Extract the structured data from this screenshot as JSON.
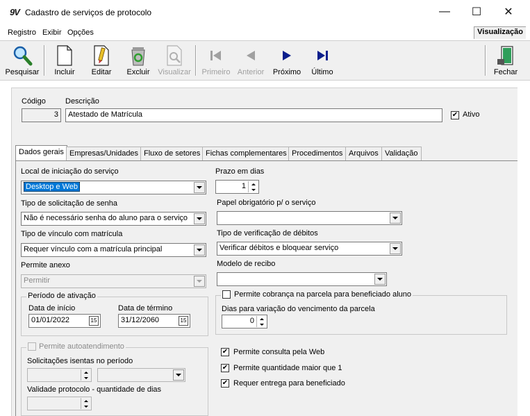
{
  "window": {
    "title": "Cadastro de serviços de protocolo",
    "app_icon": "9V",
    "controls": {
      "minimize": "—",
      "maximize": "☐",
      "close": "✕"
    }
  },
  "menu": {
    "items": [
      "Registro",
      "Exibir",
      "Opções"
    ],
    "mode_label": "Visualização"
  },
  "toolbar": {
    "buttons": [
      {
        "label": "Pesquisar",
        "icon": "magnifier-icon",
        "enabled": true
      },
      {
        "label": "Incluir",
        "icon": "new-page-icon",
        "enabled": true
      },
      {
        "label": "Editar",
        "icon": "edit-pencil-icon",
        "enabled": true
      },
      {
        "label": "Excluir",
        "icon": "recycle-bin-icon",
        "enabled": true
      },
      {
        "label": "Visualizar",
        "icon": "view-page-icon",
        "enabled": false
      },
      {
        "label": "Primeiro",
        "icon": "first-record-icon",
        "enabled": false
      },
      {
        "label": "Anterior",
        "icon": "previous-record-icon",
        "enabled": false
      },
      {
        "label": "Próximo",
        "icon": "next-record-icon",
        "enabled": true
      },
      {
        "label": "Último",
        "icon": "last-record-icon",
        "enabled": true
      },
      {
        "label": "Fechar",
        "icon": "exit-door-icon",
        "enabled": true
      }
    ],
    "colors": {
      "nav_active": "#0a1e8c",
      "nav_disabled": "#a0a0a0"
    }
  },
  "header": {
    "codigo_label": "Código",
    "codigo_value": "3",
    "descricao_label": "Descrição",
    "descricao_value": "Atestado de Matrícula",
    "ativo_label": "Ativo",
    "ativo_checked": true
  },
  "tabs": [
    {
      "label": "Dados gerais",
      "active": true
    },
    {
      "label": "Empresas/Unidades",
      "active": false
    },
    {
      "label": "Fluxo de setores",
      "active": false
    },
    {
      "label": "Fichas complementares",
      "active": false
    },
    {
      "label": "Procedimentos",
      "active": false
    },
    {
      "label": "Arquivos",
      "active": false
    },
    {
      "label": "Validação",
      "active": false
    }
  ],
  "form": {
    "local_label": "Local de iniciação do serviço",
    "local_value": "Desktop e Web",
    "prazo_label": "Prazo em dias",
    "prazo_value": "1",
    "tipo_senha_label": "Tipo de solicitação de senha",
    "tipo_senha_value": "Não é necessário senha do aluno para o serviço",
    "papel_label": "Papel obrigatório p/ o serviço",
    "papel_value": "",
    "vinculo_label": "Tipo de vínculo com matrícula",
    "vinculo_value": "Requer vínculo com a matrícula principal",
    "debitos_label": "Tipo de verificação de débitos",
    "debitos_value": "Verificar débitos e bloquear serviço",
    "anexo_label": "Permite anexo",
    "anexo_value": "Permitir",
    "recibo_label": "Modelo de recibo",
    "recibo_value": "",
    "periodo": {
      "title": "Período de ativação",
      "inicio_label": "Data de início",
      "inicio_value": "01/01/2022",
      "termino_label": "Data de término",
      "termino_value": "31/12/2060",
      "cal_icon": "15"
    },
    "cobranca": {
      "title": "Permite cobrança na parcela para beneficiado aluno",
      "checked": false,
      "dias_label": "Dias para variação do vencimento da parcela",
      "dias_value": "0"
    },
    "autoatendimento": {
      "title": "Permite autoatendimento",
      "checked": false,
      "isentas_label": "Solicitações isentas no período",
      "isentas_value": "",
      "periodo_value": "",
      "validade_label": "Validade protocolo - quantidade de dias",
      "validade_value": ""
    },
    "checks": [
      {
        "label": "Permite consulta pela Web",
        "checked": true
      },
      {
        "label": "Permite quantidade maior que 1",
        "checked": true
      },
      {
        "label": "Requer entrega para beneficiado",
        "checked": true
      }
    ]
  }
}
